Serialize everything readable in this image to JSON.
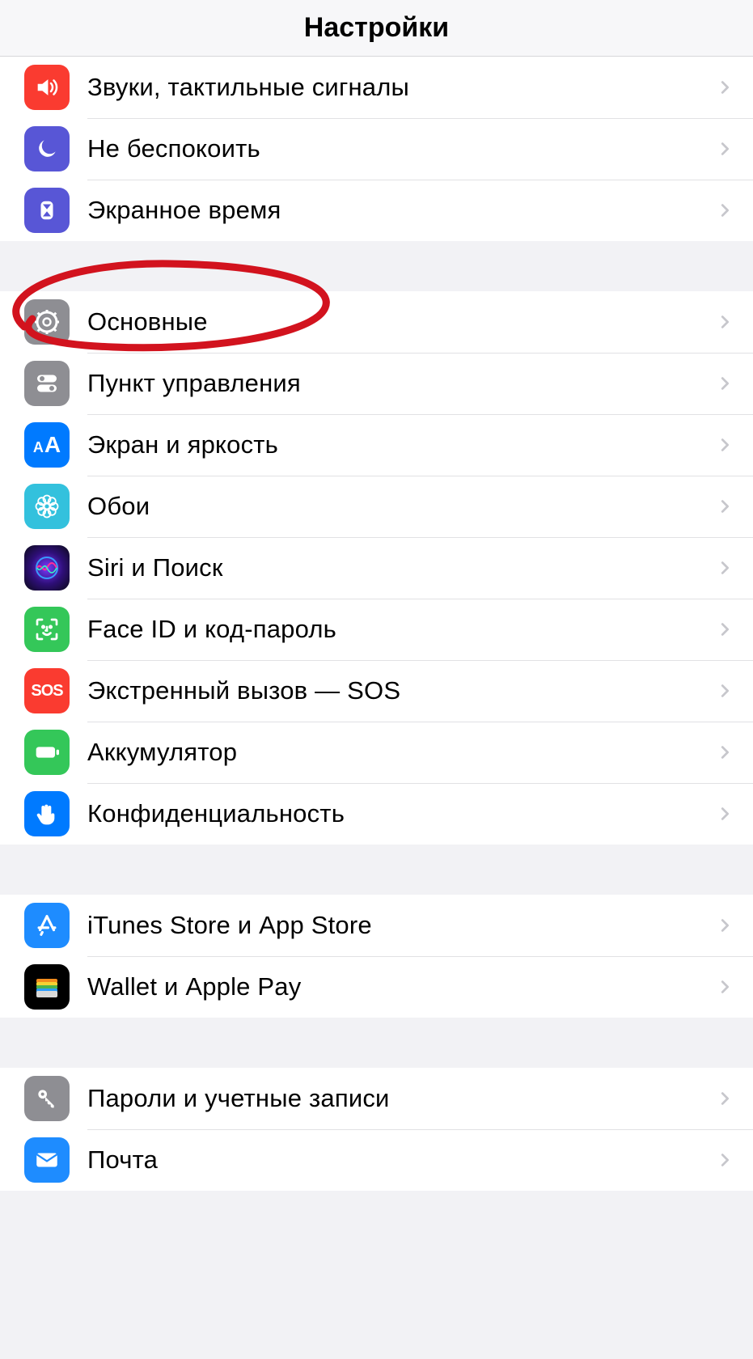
{
  "header": {
    "title": "Настройки"
  },
  "groups": [
    {
      "rows": [
        {
          "id": "sounds",
          "label": "Звуки, тактильные сигналы",
          "icon": "speaker-icon"
        },
        {
          "id": "dnd",
          "label": "Не беспокоить",
          "icon": "moon-icon"
        },
        {
          "id": "screentime",
          "label": "Экранное время",
          "icon": "hourglass-icon"
        }
      ]
    },
    {
      "rows": [
        {
          "id": "general",
          "label": "Основные",
          "icon": "gear-icon"
        },
        {
          "id": "control",
          "label": "Пункт управления",
          "icon": "toggles-icon"
        },
        {
          "id": "brightness",
          "label": "Экран и яркость",
          "icon": "aa-icon"
        },
        {
          "id": "wallpaper",
          "label": "Обои",
          "icon": "flower-icon"
        },
        {
          "id": "siri",
          "label": "Siri и Поиск",
          "icon": "siri-icon"
        },
        {
          "id": "faceid",
          "label": "Face ID и код-пароль",
          "icon": "faceid-icon"
        },
        {
          "id": "sos",
          "label": "Экстренный вызов — SOS",
          "icon": "sos-icon"
        },
        {
          "id": "battery",
          "label": "Аккумулятор",
          "icon": "battery-icon"
        },
        {
          "id": "privacy",
          "label": "Конфиденциальность",
          "icon": "hand-icon"
        }
      ]
    },
    {
      "rows": [
        {
          "id": "appstore",
          "label": "iTunes Store и App Store",
          "icon": "appstore-icon"
        },
        {
          "id": "wallet",
          "label": "Wallet и Apple Pay",
          "icon": "wallet-icon"
        }
      ]
    },
    {
      "rows": [
        {
          "id": "passwords",
          "label": "Пароли и учетные записи",
          "icon": "key-icon"
        },
        {
          "id": "mail",
          "label": "Почта",
          "icon": "mail-icon"
        }
      ]
    }
  ]
}
